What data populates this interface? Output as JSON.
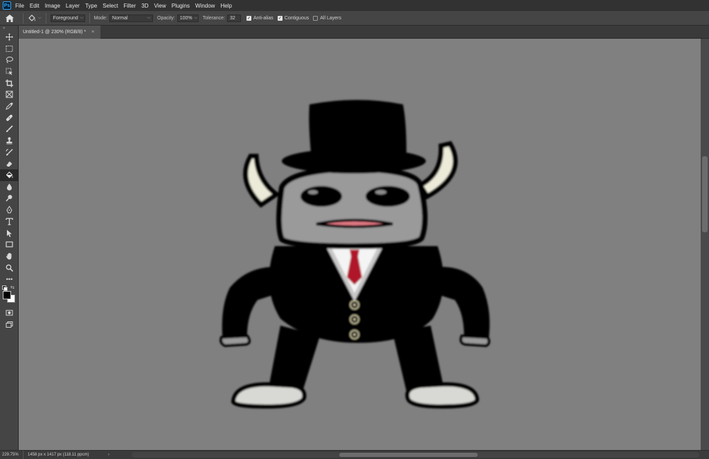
{
  "app": {
    "logo_text": "Ps"
  },
  "menu": [
    "File",
    "Edit",
    "Image",
    "Layer",
    "Type",
    "Select",
    "Filter",
    "3D",
    "View",
    "Plugins",
    "Window",
    "Help"
  ],
  "options": {
    "fill_source": "Foreground",
    "mode_label": "Mode:",
    "mode_value": "Normal",
    "opacity_label": "Opacity:",
    "opacity_value": "100%",
    "tolerance_label": "Tolerance:",
    "tolerance_value": "32",
    "anti_alias_label": "Anti-alias",
    "anti_alias_checked": true,
    "contiguous_label": "Contiguous",
    "contiguous_checked": true,
    "all_layers_label": "All Layers",
    "all_layers_checked": false
  },
  "document": {
    "tab_title": "Untitled-1 @ 230% (RGB/8) *",
    "close_glyph": "×"
  },
  "toolbar": {
    "expand_glyph": "»",
    "tools": [
      "move-icon",
      "marquee-icon",
      "lasso-icon",
      "object-select-icon",
      "crop-icon",
      "frame-icon",
      "eyedropper-icon",
      "healing-brush-icon",
      "brush-icon",
      "clone-stamp-icon",
      "history-brush-icon",
      "eraser-icon",
      "paint-bucket-icon",
      "blur-icon",
      "dodge-icon",
      "pen-icon",
      "type-icon",
      "path-select-icon",
      "rectangle-icon",
      "hand-icon",
      "zoom-icon",
      "more-tools-icon"
    ],
    "active_tool": "paint-bucket-icon",
    "foreground_color": "#000000",
    "background_color": "#ffffff"
  },
  "status": {
    "zoom": "229.75%",
    "doc_info": "1458 px x 1417 px (118.11 ppcm)",
    "arrow_glyph": "›"
  },
  "canvas": {
    "background_color": "#808080"
  }
}
